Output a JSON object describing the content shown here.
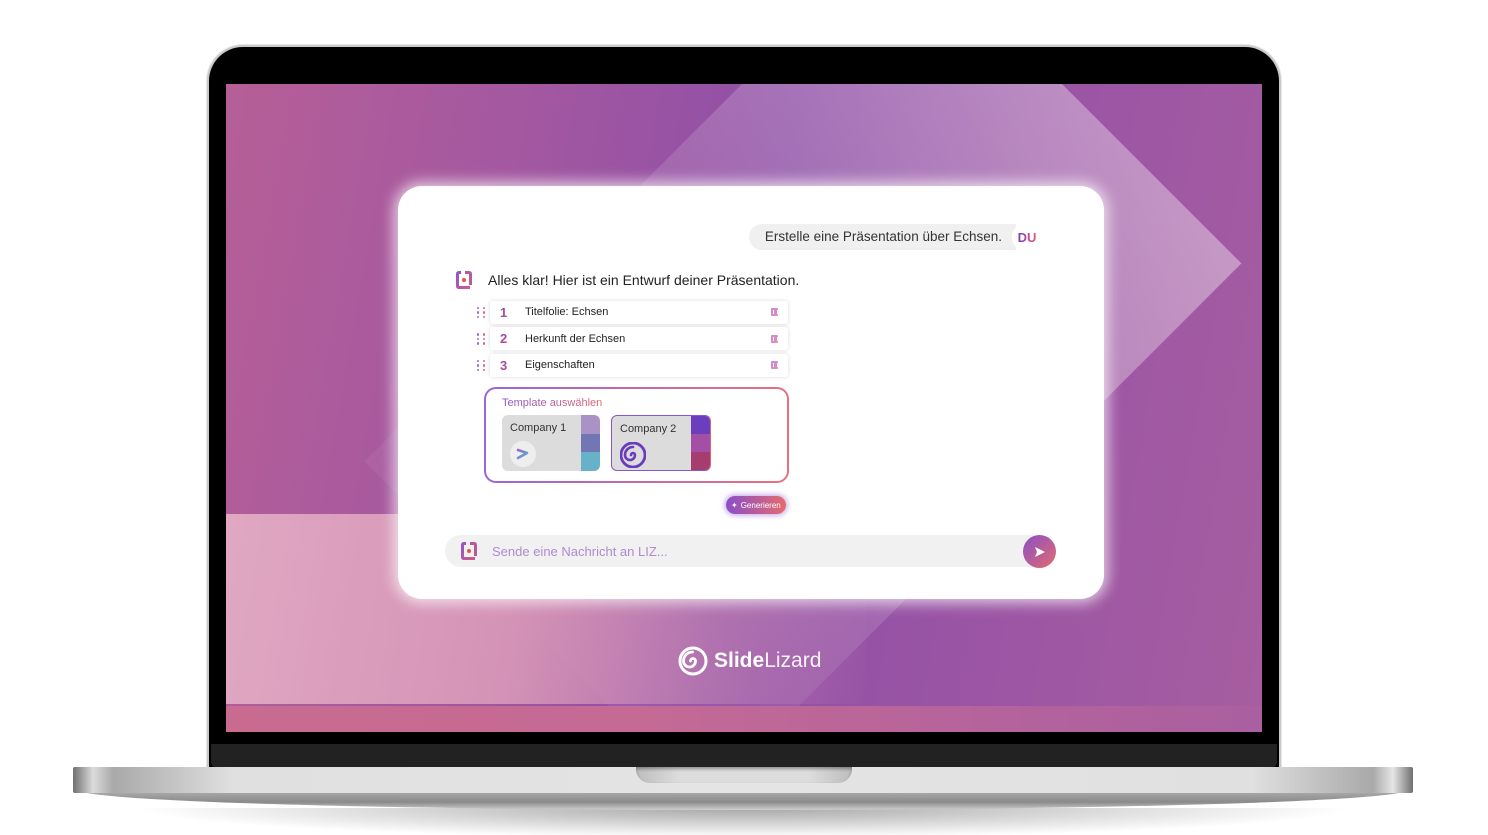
{
  "conversation": {
    "user_message": "Erstelle eine Präsentation über Echsen.",
    "user_avatar": "DU",
    "assistant_message": "Alles klar! Hier ist ein Entwurf deiner Präsentation."
  },
  "slides": [
    {
      "number": "1",
      "title": "Titelfolie: Echsen"
    },
    {
      "number": "2",
      "title": "Herkunft der Echsen"
    },
    {
      "number": "3",
      "title": "Eigenschaften"
    }
  ],
  "template_picker": {
    "label": "Template auswählen",
    "templates": [
      {
        "name": "Company 1",
        "selected": false,
        "swatches": [
          "#a892c6",
          "#7276b4",
          "#67b2c8"
        ],
        "icon": "slash-logo-icon"
      },
      {
        "name": "Company 2",
        "selected": true,
        "swatches": [
          "#6b3ebe",
          "#a34fa6",
          "#a53e6e"
        ],
        "icon": "spiral-logo-icon"
      }
    ]
  },
  "generate_button": {
    "label": "Generieren",
    "icon": "sparkle-icon"
  },
  "composer": {
    "placeholder": "Sende eine Nachricht an LIZ...",
    "value": "",
    "attach_icon": "paperclip-icon",
    "send_icon": "send-arrow-icon"
  },
  "brand": {
    "part1": "Slide",
    "part2": "Lizard"
  },
  "colors": {
    "accent_purple": "#8a4fc8",
    "accent_coral": "#e36b6e",
    "screen_bg": "#9353a6"
  }
}
